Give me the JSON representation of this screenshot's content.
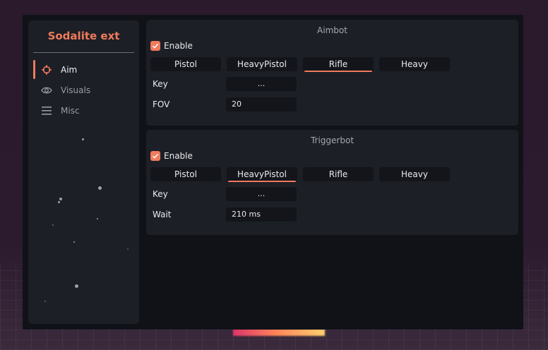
{
  "app": {
    "title": "Sodalite ext"
  },
  "sidebar": {
    "items": [
      {
        "label": "Aim",
        "icon": "crosshair-icon",
        "active": true
      },
      {
        "label": "Visuals",
        "icon": "eye-icon",
        "active": false
      },
      {
        "label": "Misc",
        "icon": "menu-icon",
        "active": false
      }
    ]
  },
  "aimbot": {
    "title": "Aimbot",
    "enable_label": "Enable",
    "enabled": true,
    "tabs": [
      "Pistol",
      "HeavyPistol",
      "Rifle",
      "Heavy"
    ],
    "active_tab": "Rifle",
    "key_label": "Key",
    "key_value": "...",
    "fov_label": "FOV",
    "fov_value": "20"
  },
  "triggerbot": {
    "title": "Triggerbot",
    "enable_label": "Enable",
    "enabled": true,
    "tabs": [
      "Pistol",
      "HeavyPistol",
      "Rifle",
      "Heavy"
    ],
    "active_tab": "HeavyPistol",
    "key_label": "Key",
    "key_value": "...",
    "wait_label": "Wait",
    "wait_value": "210 ms"
  },
  "colors": {
    "accent": "#f07a5c",
    "panel": "#1c1f26",
    "window": "#101218",
    "control": "#13151b"
  }
}
